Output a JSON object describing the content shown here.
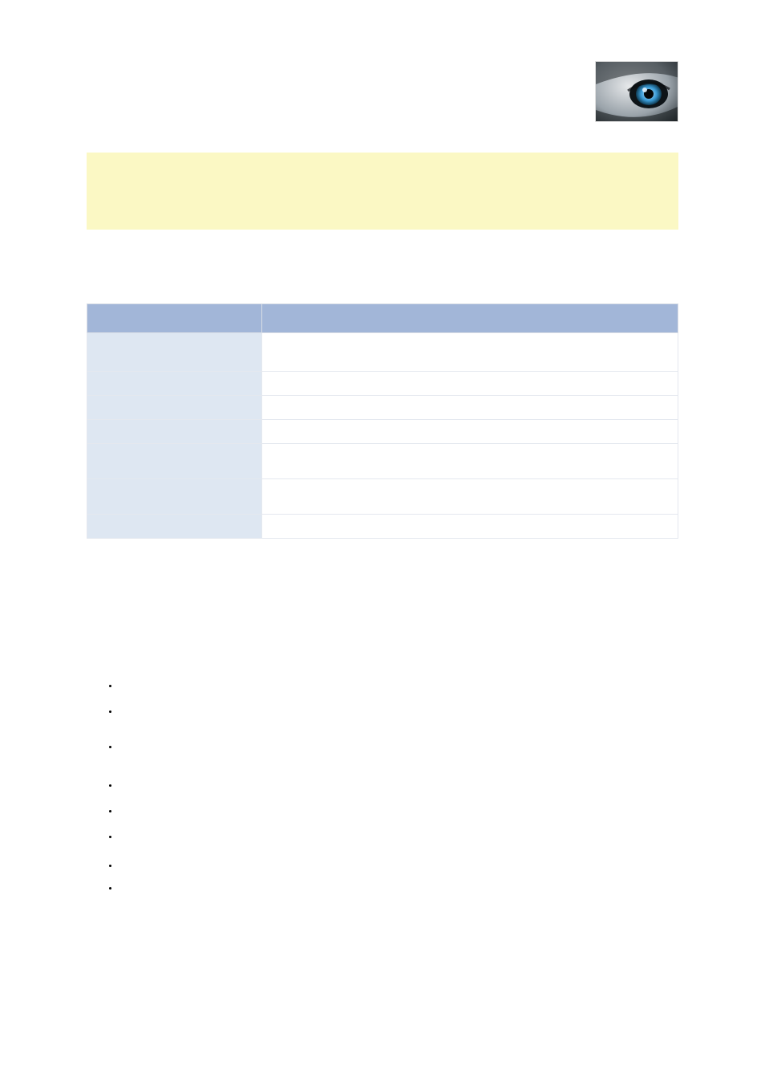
{
  "logo": {
    "name": "wolf-eye-image",
    "colors": {
      "iris": "#4aa9e0",
      "pupil": "#0a0a0a",
      "fur_light": "#d9dcdf",
      "fur_dark": "#3a4248"
    }
  },
  "callout": {
    "background": "#fbf8c4",
    "text": ""
  },
  "table": {
    "headers": [
      "",
      ""
    ],
    "rows": [
      {
        "key": "",
        "value": "",
        "height": "tall"
      },
      {
        "key": "",
        "value": "",
        "height": "short"
      },
      {
        "key": "",
        "value": "",
        "height": "short"
      },
      {
        "key": "",
        "value": "",
        "height": "short"
      },
      {
        "key": "",
        "value": "",
        "height": "med"
      },
      {
        "key": "",
        "value": "",
        "height": "med"
      },
      {
        "key": "",
        "value": "",
        "height": "short"
      }
    ]
  },
  "bullets": {
    "items": [
      "",
      "",
      "",
      "",
      "",
      "",
      "",
      ""
    ]
  }
}
